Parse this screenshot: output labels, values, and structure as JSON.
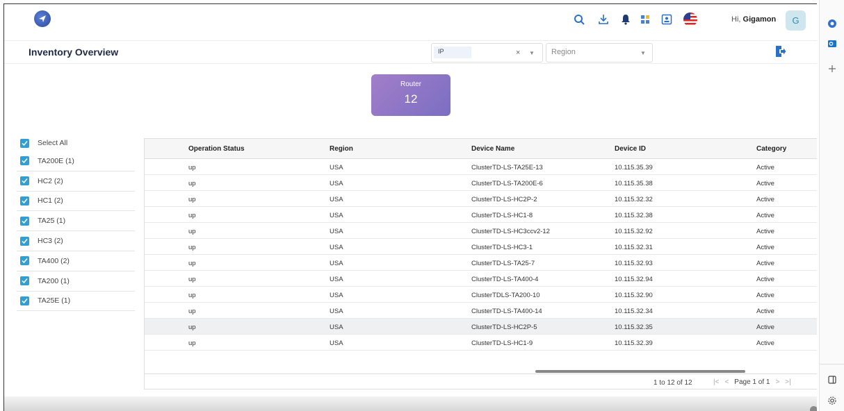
{
  "header": {
    "greeting_prefix": "Hi,",
    "user_name": "Gigamon",
    "avatar_letter": "G",
    "icons": [
      "search-icon",
      "download-icon",
      "bell-icon",
      "grid-icon",
      "contact-card-icon",
      "us-flag-icon"
    ]
  },
  "toolbar": {
    "title": "Inventory Overview",
    "ip_filter_value": "IP",
    "clear_symbol": "×",
    "region_placeholder": "Region"
  },
  "router_card": {
    "label": "Router",
    "count": "12"
  },
  "filters": [
    {
      "label": "Select All",
      "checked": true
    },
    {
      "label": "TA200E (1)",
      "checked": true
    },
    {
      "label": "HC2 (2)",
      "checked": true
    },
    {
      "label": "HC1 (2)",
      "checked": true
    },
    {
      "label": "TA25 (1)",
      "checked": true
    },
    {
      "label": "HC3 (2)",
      "checked": true
    },
    {
      "label": "TA400 (2)",
      "checked": true
    },
    {
      "label": "TA200 (1)",
      "checked": true
    },
    {
      "label": "TA25E (1)",
      "checked": true
    }
  ],
  "table": {
    "columns": [
      "Operation Status",
      "Region",
      "Device Name",
      "Device ID",
      "Category"
    ],
    "rows": [
      [
        "up",
        "USA",
        "ClusterTD-LS-TA25E-13",
        "10.115.35.39",
        "Active"
      ],
      [
        "up",
        "USA",
        "ClusterTD-LS-TA200E-6",
        "10.115.35.38",
        "Active"
      ],
      [
        "up",
        "USA",
        "ClusterTD-LS-HC2P-2",
        "10.115.32.32",
        "Active"
      ],
      [
        "up",
        "USA",
        "ClusterTD-LS-HC1-8",
        "10.115.32.38",
        "Active"
      ],
      [
        "up",
        "USA",
        "ClusterTD-LS-HC3ccv2-12",
        "10.115.32.92",
        "Active"
      ],
      [
        "up",
        "USA",
        "ClusterTD-LS-HC3-1",
        "10.115.32.31",
        "Active"
      ],
      [
        "up",
        "USA",
        "ClusterTD-LS-TA25-7",
        "10.115.32.93",
        "Active"
      ],
      [
        "up",
        "USA",
        "ClusterTD-LS-TA400-4",
        "10.115.32.94",
        "Active"
      ],
      [
        "up",
        "USA",
        "ClusterTDLS-TA200-10",
        "10.115.32.90",
        "Active"
      ],
      [
        "up",
        "USA",
        "ClusterTD-LS-TA400-14",
        "10.115.32.34",
        "Active"
      ],
      [
        "up",
        "USA",
        "ClusterTD-LS-HC2P-5",
        "10.115.32.35",
        "Active"
      ],
      [
        "up",
        "USA",
        "ClusterTD-LS-HC1-9",
        "10.115.32.39",
        "Active"
      ]
    ],
    "highlighted_row": 10,
    "row_count_text": "1 to 12 of 12",
    "page_text": "Page 1 of 1"
  },
  "colors": {
    "checkbox": "#2f9fd6",
    "router_card_start": "#a27ec9",
    "router_card_end": "#7b6ec2",
    "accent_icon": "#2a6fc9"
  }
}
